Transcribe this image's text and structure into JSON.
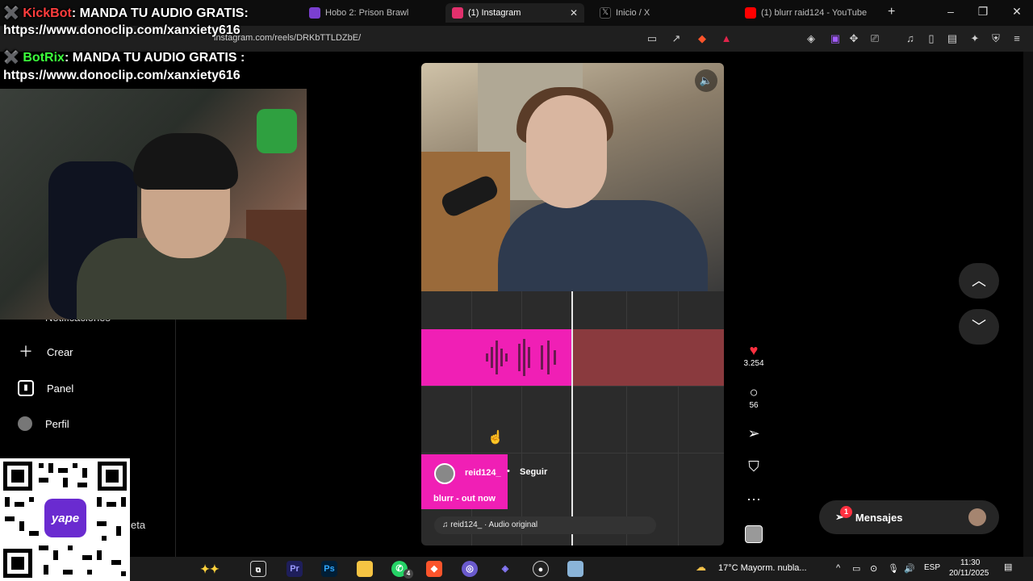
{
  "overlay": {
    "line1_prefix": "✖️ ",
    "line1_bot": "KickBot",
    "line1_msg": ": MANDA TU AUDIO GRATIS:",
    "line2": "https://www.donoclip.com/xanxiety616",
    "line3_prefix": "✖️ ",
    "line3_bot": "BotRix",
    "line3_msg": ": MANDA TU AUDIO GRATIS :",
    "line4": "https://www.donoclip.com/xanxiety616"
  },
  "browser": {
    "tabs": [
      {
        "label": "Hobo 2: Prison Brawl",
        "color": "#7a3fd0"
      },
      {
        "label": "(1) Instagram",
        "color": "#e1306c"
      },
      {
        "label": "Inicio / X",
        "color": "#000000"
      },
      {
        "label": "(1) blurr raid124 - YouTube",
        "color": "#ff0000"
      }
    ],
    "url": "instagram.com/reels/DRKbTTLDZbE/"
  },
  "sidebar": {
    "partial_item": "Notificaciones",
    "items": [
      {
        "label": "Crear",
        "icon": "plus-icon"
      },
      {
        "label": "Panel",
        "icon": "chart-icon"
      },
      {
        "label": "Perfil",
        "icon": "avatar-icon"
      }
    ],
    "cut_item": "eta"
  },
  "qr": {
    "logo": "yape"
  },
  "reel": {
    "username": "reid124_",
    "follow_label": "Seguir",
    "caption": "blurr - out now",
    "audio": "reid124_ · Audio original",
    "likes": "3.254",
    "comments": "56"
  },
  "messages": {
    "label": "Mensajes",
    "badge": "1"
  },
  "taskbar": {
    "weather": "17°C  Mayorm. nubla...",
    "lang": "ESP",
    "time": "11:30",
    "date": "20/11/2025",
    "whatsapp_badge": "4"
  },
  "colors": {
    "accent_pink": "#f01fb5",
    "like_red": "#ff3040"
  }
}
